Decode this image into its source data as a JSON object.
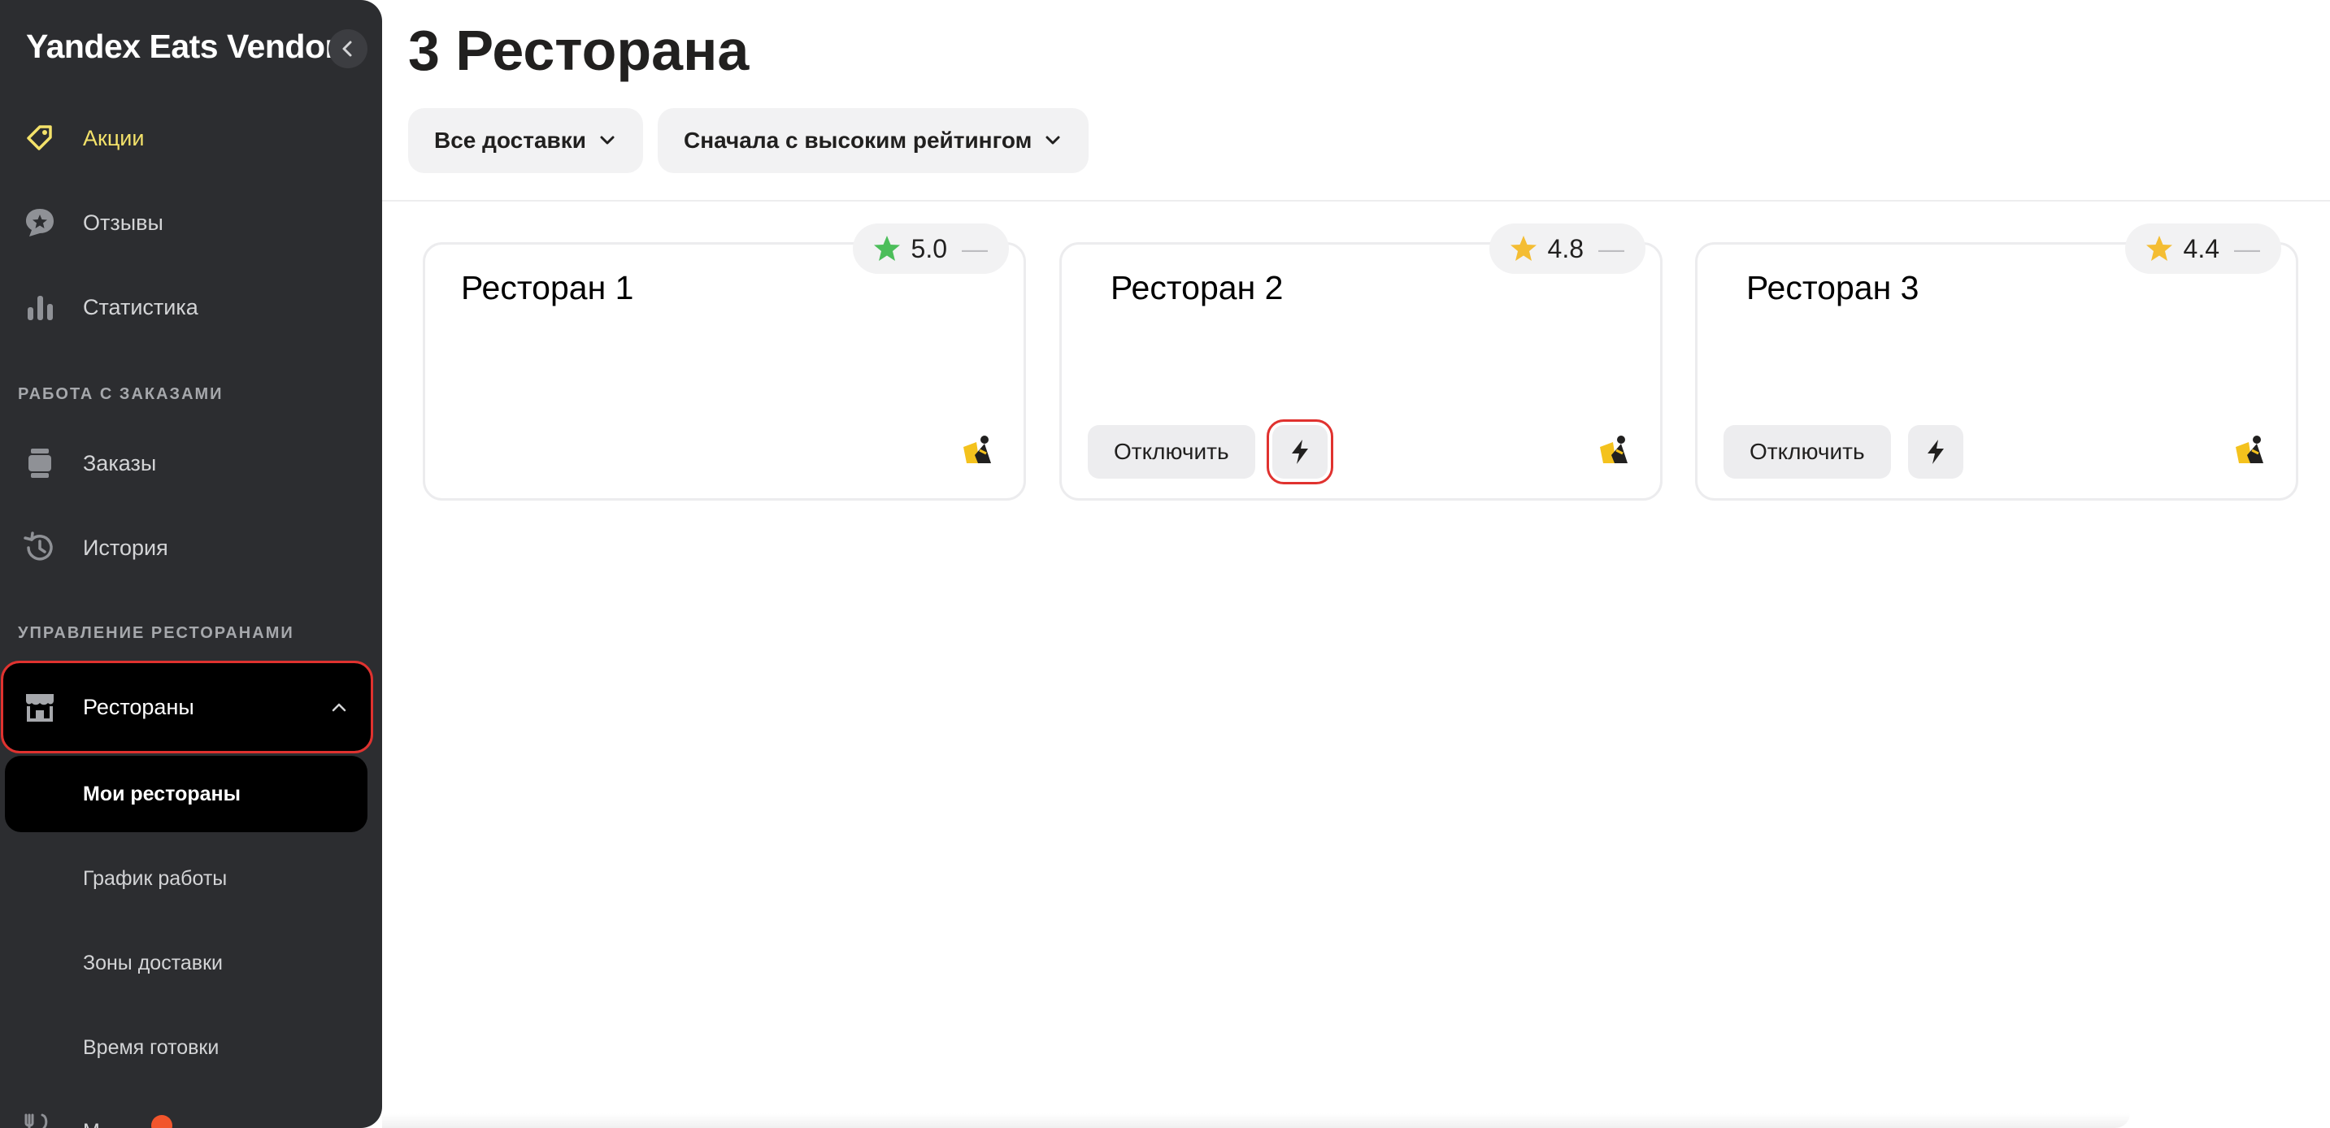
{
  "sidebar": {
    "brand": "Yandex Eats Vendor",
    "items": [
      {
        "label": "Акции",
        "icon": "tag-icon",
        "active": true
      },
      {
        "label": "Отзывы",
        "icon": "review-star-bubble-icon"
      },
      {
        "label": "Статистика",
        "icon": "bar-chart-icon"
      }
    ],
    "section_orders": "РАБОТА С ЗАКАЗАМИ",
    "orders_items": [
      {
        "label": "Заказы",
        "icon": "orders-icon"
      },
      {
        "label": "История",
        "icon": "history-icon"
      }
    ],
    "section_restaurants": "УПРАВЛЕНИЕ РЕСТОРАНАМИ",
    "restaurants": {
      "label": "Рестораны",
      "icon": "store-icon",
      "expanded": true
    },
    "restaurants_sub": [
      {
        "label": "Мои рестораны",
        "selected": true
      },
      {
        "label": "График работы"
      },
      {
        "label": "Зоны доставки"
      },
      {
        "label": "Время готовки"
      }
    ],
    "partial_item": {
      "label": "М",
      "icon": "fork-knife-icon"
    }
  },
  "main": {
    "title": "3 Ресторана",
    "filters": {
      "delivery": "Все доставки",
      "sort": "Сначала с высоким рейтингом"
    },
    "cards": [
      {
        "name": "Ресторан 1",
        "rating": "5.0",
        "rating_color": "#4cbe5a",
        "has_actions": false
      },
      {
        "name": "Ресторан 2",
        "rating": "4.8",
        "rating_color": "#f4bd33",
        "has_actions": true,
        "disable_label": "Отключить"
      },
      {
        "name": "Ресторан 3",
        "rating": "4.4",
        "rating_color": "#f4bd33",
        "has_actions": true,
        "disable_label": "Отключить"
      }
    ],
    "rating_dash": "—"
  },
  "colors": {
    "sidebar_bg": "#2c2d30",
    "active_accent": "#f4e26a",
    "highlight_border": "#e0322f",
    "notification_dot": "#f2552c"
  }
}
